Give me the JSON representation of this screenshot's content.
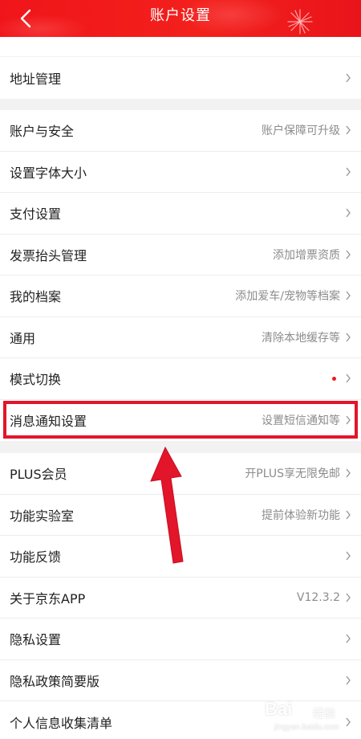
{
  "header": {
    "title": "账户设置",
    "back_icon": "chevron-left-icon",
    "accent": "#f0151a"
  },
  "group_top": {
    "items": [
      {
        "label": "地址管理",
        "value": ""
      }
    ]
  },
  "group_main": {
    "items": [
      {
        "label": "账户与安全",
        "value": "账户保障可升级"
      },
      {
        "label": "设置字体大小",
        "value": ""
      },
      {
        "label": "支付设置",
        "value": ""
      },
      {
        "label": "发票抬头管理",
        "value": "添加增票资质"
      },
      {
        "label": "我的档案",
        "value": "添加爱车/宠物等档案"
      },
      {
        "label": "通用",
        "value": "清除本地缓存等"
      },
      {
        "label": "模式切换",
        "value": ""
      },
      {
        "label": "消息通知设置",
        "value": "设置短信通知等"
      }
    ]
  },
  "group_more": {
    "items": [
      {
        "label": "PLUS会员",
        "value": "开PLUS享无限免邮"
      },
      {
        "label": "功能实验室",
        "value": "提前体验新功能"
      },
      {
        "label": "功能反馈",
        "value": ""
      },
      {
        "label": "关于京东APP",
        "value": "V12.3.2"
      },
      {
        "label": "隐私设置",
        "value": ""
      },
      {
        "label": "隐私政策简要版",
        "value": ""
      },
      {
        "label": "个人信息收集清单",
        "value": ""
      }
    ]
  },
  "watermark": {
    "logo": "Bai",
    "text": "经验",
    "url": "jingyan.baidu.com"
  },
  "colors": {
    "highlight": "#e2152a",
    "arrow": "#e2152a",
    "badge_dot": "#f0171c"
  }
}
